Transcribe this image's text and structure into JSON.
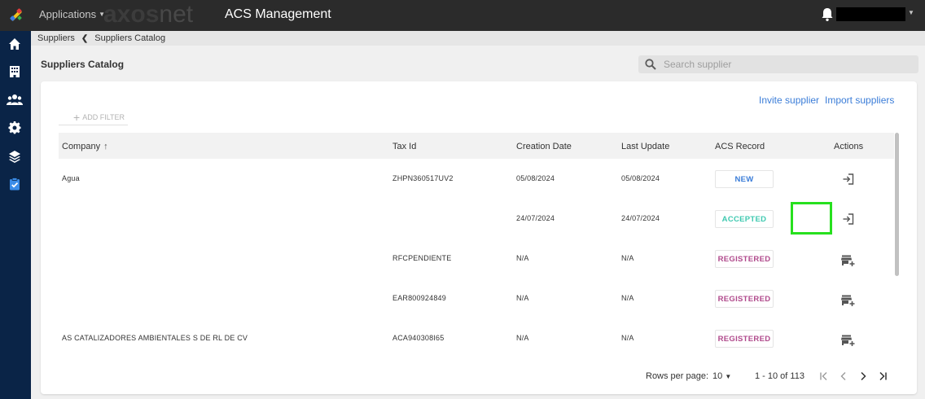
{
  "topbar": {
    "apps_label": "Applications",
    "brand_bold": "axos",
    "brand_light": "net",
    "module_title": "ACS Management"
  },
  "breadcrumb": {
    "parent": "Suppliers",
    "current": "Suppliers Catalog"
  },
  "page": {
    "title": "Suppliers Catalog"
  },
  "search": {
    "placeholder": "Search supplier"
  },
  "actions": {
    "invite": "Invite supplier",
    "import": "Import suppliers",
    "add_filter": "ADD FILTER"
  },
  "table": {
    "headers": {
      "company": "Company",
      "tax_id": "Tax Id",
      "creation_date": "Creation Date",
      "last_update": "Last Update",
      "acs_record": "ACS Record",
      "actions": "Actions"
    },
    "rows": [
      {
        "company": "Agua",
        "tax_id": "ZHPN360517UV2",
        "creation_date": "05/08/2024",
        "last_update": "05/08/2024",
        "acs_record": "NEW",
        "action_icon": "login-arrow-icon"
      },
      {
        "company": "",
        "tax_id": "",
        "creation_date": "24/07/2024",
        "last_update": "24/07/2024",
        "acs_record": "ACCEPTED",
        "action_icon": "login-arrow-icon"
      },
      {
        "company": "",
        "tax_id": "RFCPENDIENTE",
        "creation_date": "N/A",
        "last_update": "N/A",
        "acs_record": "REGISTERED",
        "action_icon": "add-store-icon"
      },
      {
        "company": "",
        "tax_id": "EAR800924849",
        "creation_date": "N/A",
        "last_update": "N/A",
        "acs_record": "REGISTERED",
        "action_icon": "add-store-icon"
      },
      {
        "company": "AS CATALIZADORES AMBIENTALES S DE RL DE CV",
        "tax_id": "ACA940308I65",
        "creation_date": "N/A",
        "last_update": "N/A",
        "acs_record": "REGISTERED",
        "action_icon": "add-store-icon"
      }
    ]
  },
  "pagination": {
    "rows_per_page_label": "Rows per page:",
    "rows_per_page_value": "10",
    "range": "1 - 10 of 113"
  },
  "colors": {
    "sidebar": "#0a2447",
    "topbar": "#2b2b2b",
    "link": "#3b7dd8",
    "badge_new": "#3b7dd8",
    "badge_accepted": "#3fc9b0",
    "badge_registered": "#b04a8c",
    "highlight": "#27e01e"
  }
}
